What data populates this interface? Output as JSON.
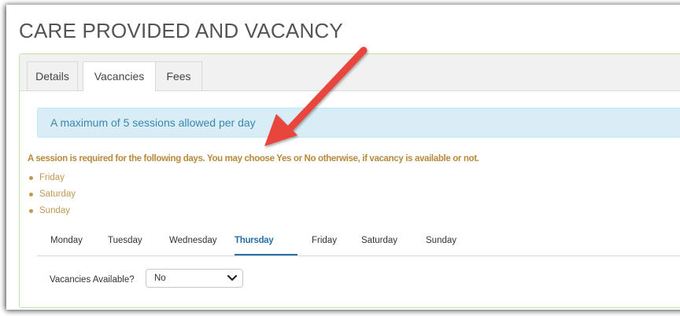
{
  "page": {
    "title": "CARE PROVIDED AND VACANCY"
  },
  "tabs": [
    {
      "label": "Details"
    },
    {
      "label": "Vacancies"
    },
    {
      "label": "Fees"
    }
  ],
  "active_tab": "Vacancies",
  "info_message": "A maximum of 5 sessions allowed per day",
  "warning": {
    "text": "A session is required for the following days. You may choose Yes or No otherwise, if vacancy is available or not.",
    "days": [
      "Friday",
      "Saturday",
      "Sunday"
    ]
  },
  "day_tabs": [
    "Monday",
    "Tuesday",
    "Wednesday",
    "Thursday",
    "Friday",
    "Saturday",
    "Sunday"
  ],
  "active_day": "Thursday",
  "vacancies": {
    "label": "Vacancies Available?",
    "selected": "No"
  },
  "colors": {
    "panel_border": "#bfe3a6",
    "info_bg": "#d9edf7",
    "info_text": "#3a87ad",
    "warning_text": "#b8893d",
    "active_day": "#2b6fa6",
    "annotation_arrow": "#e8453c"
  },
  "icons": {
    "select": "chevron-down-icon",
    "annotation": "red-arrow"
  }
}
